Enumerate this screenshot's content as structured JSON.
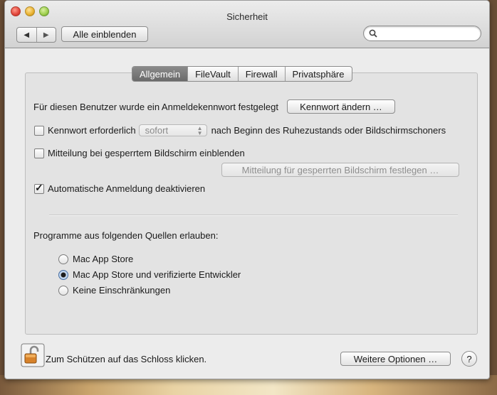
{
  "window": {
    "title": "Sicherheit"
  },
  "toolbar": {
    "back_glyph": "◀",
    "forward_glyph": "▶",
    "show_all_label": "Alle einblenden",
    "search_placeholder": ""
  },
  "tabs": [
    {
      "label": "Allgemein",
      "active": true
    },
    {
      "label": "FileVault",
      "active": false
    },
    {
      "label": "Firewall",
      "active": false
    },
    {
      "label": "Privatsphäre",
      "active": false
    }
  ],
  "general": {
    "password_text": "Für diesen Benutzer wurde ein Anmeldekennwort festgelegt",
    "change_password_label": "Kennwort ändern …",
    "require_password_label": "Kennwort erforderlich",
    "require_password_checked": false,
    "require_password_delay": "sofort",
    "require_password_suffix": "nach Beginn des Ruhezustands oder Bildschirmschoners",
    "lock_message_label": "Mitteilung bei gesperrtem Bildschirm einblenden",
    "lock_message_checked": false,
    "set_lock_message_label": "Mitteilung für gesperrten Bildschirm festlegen …",
    "disable_autologin_label": "Automatische Anmeldung deaktivieren",
    "disable_autologin_checked": true
  },
  "gatekeeper": {
    "heading": "Programme aus folgenden Quellen erlauben:",
    "options": [
      {
        "label": "Mac App Store",
        "selected": false
      },
      {
        "label": "Mac App Store und verifizierte Entwickler",
        "selected": true
      },
      {
        "label": "Keine Einschränkungen",
        "selected": false
      }
    ]
  },
  "footer": {
    "lock_text": "Zum Schützen auf das Schloss klicken.",
    "advanced_label": "Weitere Optionen …",
    "help_label": "?"
  },
  "icons": [
    "close-icon",
    "minimize-icon",
    "zoom-icon",
    "search-icon",
    "lock-icon",
    "help-icon"
  ]
}
